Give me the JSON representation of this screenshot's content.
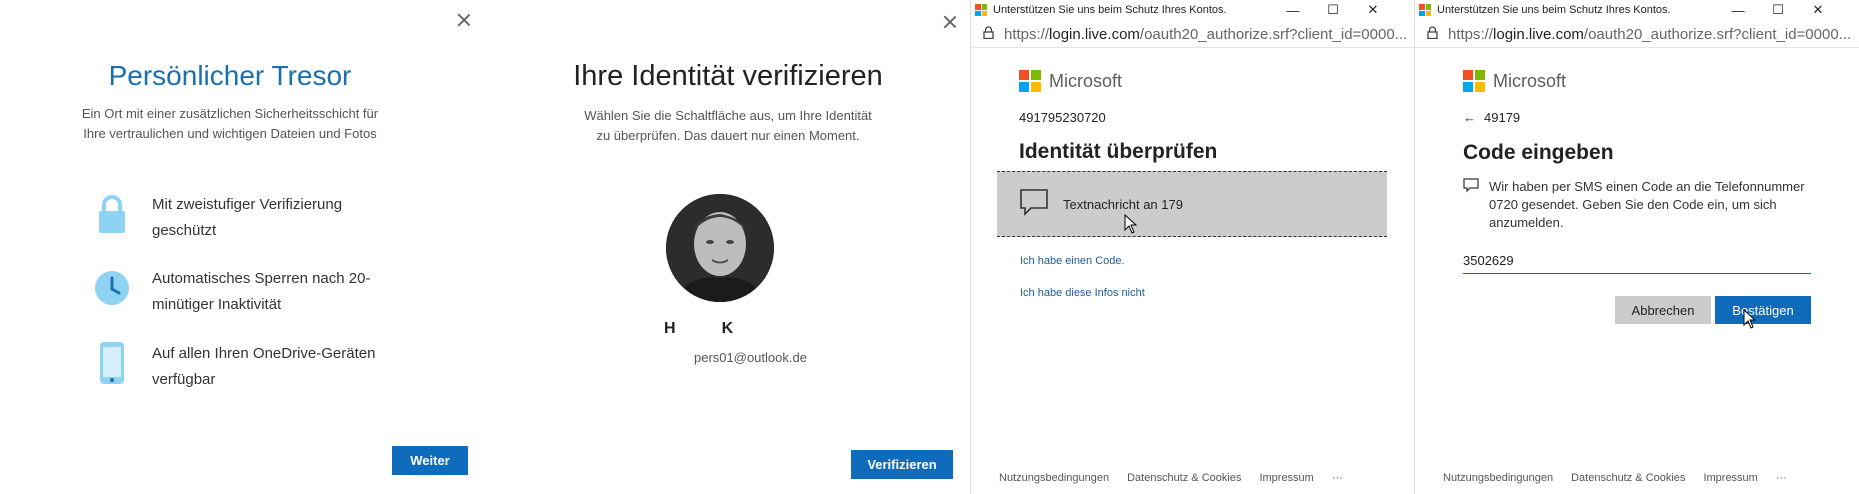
{
  "panel1": {
    "title": "Persönlicher Tresor",
    "subtitle": "Ein Ort mit einer zusätzlichen Sicherheitsschicht für Ihre vertraulichen und wichtigen Dateien und Fotos",
    "features": [
      {
        "icon": "lock-icon",
        "text": "Mit zweistufiger Verifizierung geschützt"
      },
      {
        "icon": "clock-icon",
        "text": "Automatisches Sperren nach 20-minütiger Inaktivität"
      },
      {
        "icon": "phone-icon",
        "text": "Auf allen Ihren OneDrive-Geräten verfügbar"
      }
    ],
    "button": "Weiter"
  },
  "panel2": {
    "title": "Ihre Identität verifizieren",
    "subtitle": "Wählen Sie die Schaltfläche aus, um Ihre Identität zu überprüfen. Das dauert nur einen Moment.",
    "name_first": "H",
    "name_last": "K",
    "email": "pers01@outlook.de",
    "button": "Verifizieren"
  },
  "panel3": {
    "window_title": "Unterstützen Sie uns beim Schutz Ihres Kontos.",
    "url_prefix": "https://",
    "url_host": "login.live.com",
    "url_rest": "/oauth20_authorize.srf?client_id=0000...",
    "brand": "Microsoft",
    "account": "491795230720",
    "heading": "Identität überprüfen",
    "option": "Textnachricht an 179",
    "link1": "Ich habe einen Code.",
    "link2": "Ich habe diese Infos nicht",
    "footer": [
      "Nutzungsbedingungen",
      "Datenschutz & Cookies",
      "Impressum",
      "···"
    ]
  },
  "panel4": {
    "window_title": "Unterstützen Sie uns beim Schutz Ihres Kontos.",
    "url_prefix": "https://",
    "url_host": "login.live.com",
    "url_rest": "/oauth20_authorize.srf?client_id=0000...",
    "brand": "Microsoft",
    "back_account": "49179",
    "heading": "Code eingeben",
    "info": "Wir haben per SMS einen Code an die Telefonnummer 0720 gesendet. Geben Sie den Code ein, um sich anzumelden.",
    "code_value": "3502629",
    "cancel": "Abbrechen",
    "confirm": "Bestätigen",
    "footer": [
      "Nutzungsbedingungen",
      "Datenschutz & Cookies",
      "Impressum",
      "···"
    ]
  },
  "colors": {
    "accent": "#0f6cbd",
    "title_blue": "#1a6fb0",
    "icon_blue": "#8fd3f2"
  }
}
